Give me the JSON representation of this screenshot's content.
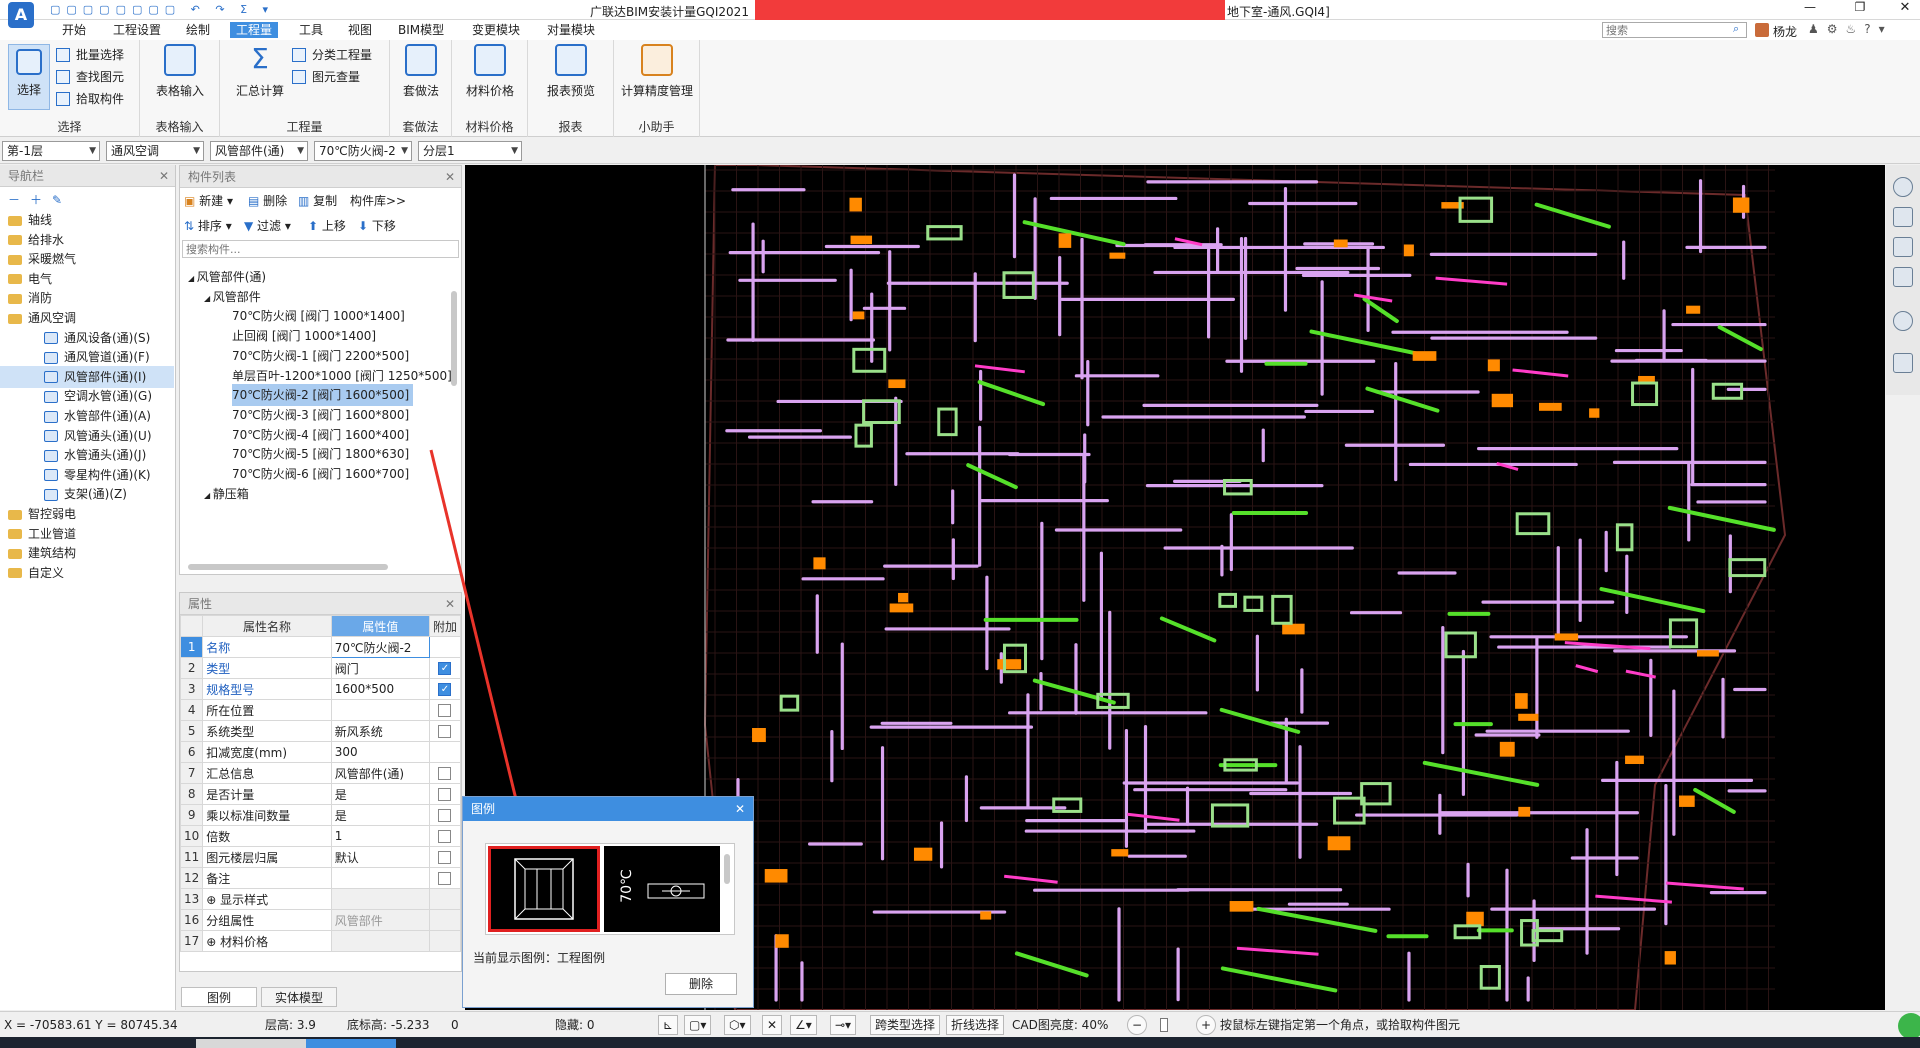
{
  "window": {
    "title": "广联达BIM安装计量GQI2021",
    "title_suffix": "地下室-通风.GQI4]",
    "search_placeholder": "搜索",
    "user": "杨龙"
  },
  "menu": {
    "items": [
      "开始",
      "工程设置",
      "绘制",
      "工程量",
      "工具",
      "视图",
      "BIM模型",
      "变更模块",
      "对量模块"
    ],
    "active_index": 3
  },
  "ribbon": {
    "groups": [
      {
        "label": "选择",
        "big": "选择",
        "small": [
          "批量选择",
          "查找图元",
          "拾取构件"
        ]
      },
      {
        "label": "表格输入",
        "big": "表格输入"
      },
      {
        "label": "工程量",
        "big": "汇总计算",
        "small": [
          "分类工程量",
          "图元查量"
        ]
      },
      {
        "label": "套做法",
        "big": "套做法"
      },
      {
        "label": "材料价格",
        "big": "材料价格"
      },
      {
        "label": "报表",
        "big": "报表预览"
      },
      {
        "label": "小助手",
        "big": "计算精度管理"
      }
    ]
  },
  "filters": {
    "floor": "第-1层",
    "discipline": "通风空调",
    "type": "风管部件(通)",
    "component": "70℃防火阀-2",
    "layer": "分层1"
  },
  "nav": {
    "title": "导航栏",
    "items": [
      {
        "label": "轴线",
        "level": 0
      },
      {
        "label": "给排水",
        "level": 0
      },
      {
        "label": "采暖燃气",
        "level": 0
      },
      {
        "label": "电气",
        "level": 0
      },
      {
        "label": "消防",
        "level": 0
      },
      {
        "label": "通风空调",
        "level": 0
      },
      {
        "label": "通风设备(通)(S)",
        "level": 1
      },
      {
        "label": "通风管道(通)(F)",
        "level": 1
      },
      {
        "label": "风管部件(通)(I)",
        "level": 1,
        "selected": true
      },
      {
        "label": "空调水管(通)(G)",
        "level": 1
      },
      {
        "label": "水管部件(通)(A)",
        "level": 1
      },
      {
        "label": "风管通头(通)(U)",
        "level": 1
      },
      {
        "label": "水管通头(通)(J)",
        "level": 1
      },
      {
        "label": "零星构件(通)(K)",
        "level": 1
      },
      {
        "label": "支架(通)(Z)",
        "level": 1
      },
      {
        "label": "智控弱电",
        "level": 0
      },
      {
        "label": "工业管道",
        "level": 0
      },
      {
        "label": "建筑结构",
        "level": 0
      },
      {
        "label": "自定义",
        "level": 0
      }
    ]
  },
  "component_list": {
    "title": "构件列表",
    "toolbar": [
      "新建",
      "删除",
      "复制",
      "构件库>>"
    ],
    "toolbar2": [
      "排序",
      "过滤",
      "上移",
      "下移"
    ],
    "search_placeholder": "搜索构件...",
    "tree": [
      {
        "label": "风管部件(通)",
        "level": 0
      },
      {
        "label": "风管部件",
        "level": 1
      },
      {
        "label": "70℃防火阀 [阀门 1000*1400]",
        "level": 2
      },
      {
        "label": "止回阀 [阀门 1000*1400]",
        "level": 2
      },
      {
        "label": "70℃防火阀-1 [阀门 2200*500]",
        "level": 2
      },
      {
        "label": "单层百叶-1200*1000 [阀门 1250*500]",
        "level": 2
      },
      {
        "label": "70℃防火阀-2 [阀门 1600*500]",
        "level": 2,
        "selected": true
      },
      {
        "label": "70℃防火阀-3 [阀门 1600*800]",
        "level": 2
      },
      {
        "label": "70℃防火阀-4 [阀门 1600*400]",
        "level": 2
      },
      {
        "label": "70℃防火阀-5 [阀门 1800*630]",
        "level": 2
      },
      {
        "label": "70℃防火阀-6 [阀门 1600*700]",
        "level": 2
      },
      {
        "label": "静压箱",
        "level": 1
      }
    ]
  },
  "properties": {
    "title": "属性",
    "headers": [
      "属性名称",
      "属性值",
      "附加"
    ],
    "rows": [
      {
        "n": "1",
        "name": "名称",
        "value": "70℃防火阀-2",
        "blue": true,
        "cb": "none"
      },
      {
        "n": "2",
        "name": "类型",
        "value": "阀门",
        "blue": true,
        "cb": "on"
      },
      {
        "n": "3",
        "name": "规格型号",
        "value": "1600*500",
        "blue": true,
        "cb": "on"
      },
      {
        "n": "4",
        "name": "所在位置",
        "value": "",
        "cb": "off"
      },
      {
        "n": "5",
        "name": "系统类型",
        "value": "新风系统",
        "cb": "off"
      },
      {
        "n": "6",
        "name": "扣减宽度(mm)",
        "value": "300",
        "cb": "none"
      },
      {
        "n": "7",
        "name": "汇总信息",
        "value": "风管部件(通)",
        "cb": "off"
      },
      {
        "n": "8",
        "name": "是否计量",
        "value": "是",
        "cb": "off"
      },
      {
        "n": "9",
        "name": "乘以标准间数量",
        "value": "是",
        "cb": "off"
      },
      {
        "n": "10",
        "name": "倍数",
        "value": "1",
        "cb": "off"
      },
      {
        "n": "11",
        "name": "图元楼层归属",
        "value": "默认",
        "cb": "off"
      },
      {
        "n": "12",
        "name": "备注",
        "value": "",
        "cb": "off"
      },
      {
        "n": "13",
        "name": "⊕ 显示样式",
        "value": "",
        "cb": "none",
        "gray": true
      },
      {
        "n": "16",
        "name": "分组属性",
        "value": "风管部件",
        "cb": "none",
        "gray": true
      },
      {
        "n": "17",
        "name": "⊕ 材料价格",
        "value": "",
        "cb": "none",
        "gray": true
      }
    ]
  },
  "bottom_tabs": [
    "图例",
    "实体模型"
  ],
  "legend": {
    "title": "图例",
    "symbol_text": "70℃",
    "current_label": "当前显示图例：工程图例",
    "delete_label": "删除"
  },
  "status": {
    "coords": "X = -70583.61 Y = 80745.34",
    "floor_height": "层高: 3.9",
    "base_elevation": "底标高: -5.233",
    "zero": "0",
    "hidden": "隐藏: 0",
    "cross_select": "跨类型选择",
    "polyline_select": "折线选择",
    "cad_brightness": "CAD图亮度: 40%",
    "hint": "按鼠标左键指定第一个角点，或拾取构件图元"
  },
  "colors": {
    "accent": "#3e8ee0",
    "duct": "#d9a3f0",
    "green_duct": "#55e02a",
    "orange": "#ff8a00",
    "magenta": "#ff3cc8",
    "arrow": "#e8332a"
  }
}
